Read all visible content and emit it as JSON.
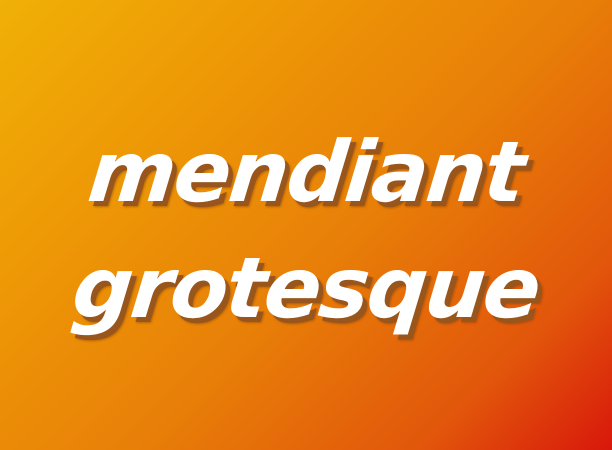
{
  "lines": [
    "mendiant",
    "grotesque"
  ],
  "colors": {
    "text": "#FFFFFF",
    "shadow": "#98551C",
    "gradient_start": "#F0B006",
    "gradient_mid": "#E87F08",
    "gradient_end": "#D8170B"
  }
}
